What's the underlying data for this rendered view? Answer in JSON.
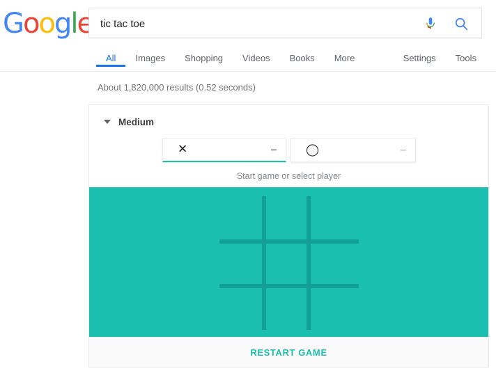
{
  "header": {
    "logo": {
      "letters": [
        {
          "ch": "G",
          "color": "#4285F4"
        },
        {
          "ch": "o",
          "color": "#EA4335"
        },
        {
          "ch": "o",
          "color": "#FBBC05"
        },
        {
          "ch": "g",
          "color": "#4285F4"
        },
        {
          "ch": "l",
          "color": "#34A853"
        },
        {
          "ch": "e",
          "color": "#EA4335"
        }
      ],
      "alt": "Google"
    },
    "search": {
      "value": "tic tac toe",
      "placeholder": "Search",
      "mic_icon": "microphone-icon",
      "search_icon": "search-icon"
    }
  },
  "nav": {
    "left_tabs": [
      {
        "label": "All",
        "active": true
      },
      {
        "label": "Images",
        "active": false
      },
      {
        "label": "Shopping",
        "active": false
      },
      {
        "label": "Videos",
        "active": false
      },
      {
        "label": "Books",
        "active": false
      },
      {
        "label": "More",
        "active": false
      }
    ],
    "right_tabs": [
      {
        "label": "Settings"
      },
      {
        "label": "Tools"
      }
    ]
  },
  "results": {
    "stats": "About 1,820,000 results (0.52 seconds)"
  },
  "game": {
    "difficulty_label": "Medium",
    "caret_icon": "chevron-down-icon",
    "players": [
      {
        "mark": "✕",
        "name": "player-x-select",
        "selected": true,
        "dash": "–"
      },
      {
        "mark": "◯",
        "name": "player-o-select",
        "selected": false,
        "dash": "–"
      }
    ],
    "hint": "Start game or select player",
    "board": {
      "rows": 3,
      "cols": 3,
      "cells": [
        [
          "",
          "",
          ""
        ],
        [
          "",
          "",
          ""
        ],
        [
          "",
          "",
          ""
        ]
      ],
      "bg_color": "#1ABFB0",
      "line_color": "#12A096"
    },
    "restart_label": "RESTART GAME",
    "accent_color": "#1DBFAF"
  }
}
